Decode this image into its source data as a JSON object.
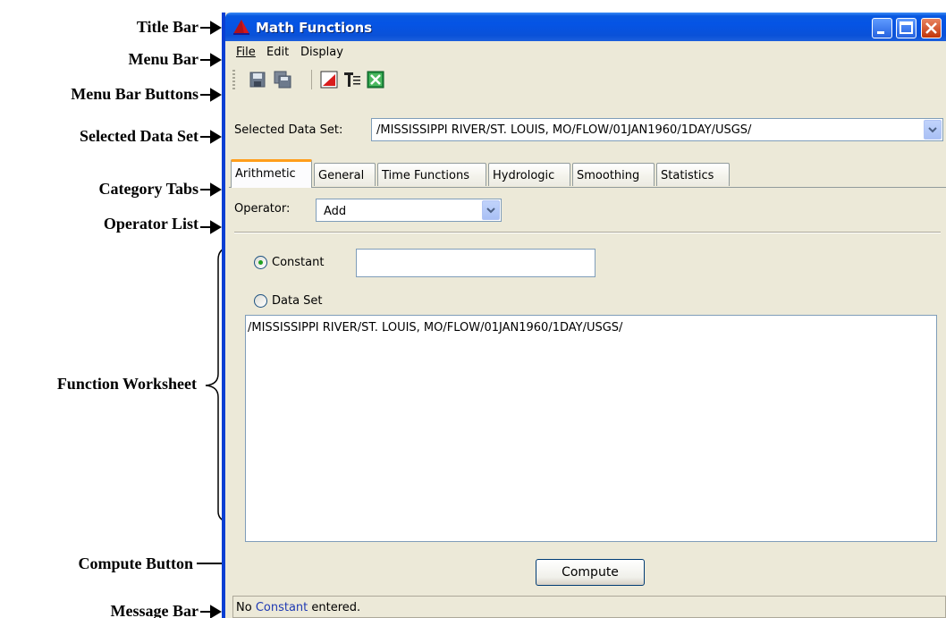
{
  "annotations": {
    "title_bar": "Title Bar",
    "menu_bar": "Menu Bar",
    "menu_bar_buttons": "Menu Bar Buttons",
    "selected_data_set": "Selected Data Set",
    "category_tabs": "Category Tabs",
    "operator_list": "Operator List",
    "function_worksheet": "Function Worksheet",
    "compute_button": "Compute Button",
    "message_bar": "Message Bar"
  },
  "window": {
    "title": "Math Functions"
  },
  "menu": {
    "file": "File",
    "edit": "Edit",
    "display": "Display"
  },
  "toolbar": {
    "icons": [
      "save-icon",
      "save-all-icon",
      "plot-icon",
      "table-icon",
      "excel-icon"
    ]
  },
  "dataset": {
    "label": "Selected Data Set:",
    "value": "/MISSISSIPPI RIVER/ST. LOUIS, MO/FLOW/01JAN1960/1DAY/USGS/"
  },
  "tabs": [
    "Arithmetic",
    "General",
    "Time Functions",
    "Hydrologic",
    "Smoothing",
    "Statistics"
  ],
  "operator": {
    "label": "Operator:",
    "value": "Add"
  },
  "options": {
    "constant_label": "Constant",
    "constant_value": "",
    "dataset_label": "Data Set"
  },
  "worksheet": {
    "text": "/MISSISSIPPI RIVER/ST. LOUIS, MO/FLOW/01JAN1960/1DAY/USGS/"
  },
  "compute": {
    "label": "Compute"
  },
  "message": {
    "prefix": "No ",
    "keyword": "Constant",
    "suffix": " entered."
  },
  "colors": {
    "title_bar": "#0554e5",
    "active_tab_accent": "#ff9e1b",
    "message_keyword": "#1f3ab3"
  }
}
